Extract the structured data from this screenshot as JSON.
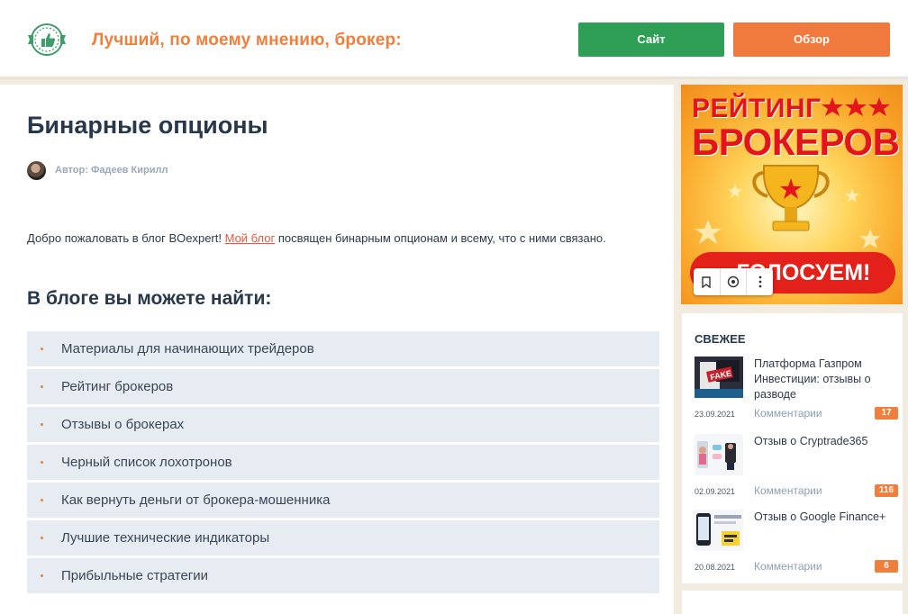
{
  "header": {
    "tagline": "Лучший, по моему мнению, брокер:",
    "site_button": "Сайт",
    "review_button": "Обзор",
    "colors": {
      "accent_orange": "#f07f3e",
      "site_green": "#2e9f55"
    }
  },
  "article": {
    "title": "Бинарные опционы",
    "author": "Автор: Фадеев Кирилл",
    "intro_before": "Добро пожаловать в блог BOexpert! ",
    "intro_link": "Мой блог",
    "intro_after": " посвящен бинарным опционам и всему, что с ними связано.",
    "section_heading": "В блоге вы можете найти:",
    "list": [
      "Материалы для начинающих трейдеров",
      "Рейтинг брокеров",
      "Отзывы о брокерах",
      "Черный список лохотронов",
      "Как вернуть деньги от брокера-мошенника",
      "Лучшие технические индикаторы",
      "Прибыльные стратегии"
    ]
  },
  "banner": {
    "line1": "РЕЙТИНГ",
    "line2": "БРОКЕРОВ",
    "vote": "ГОЛОСУЕМ!",
    "controls": [
      "bookmark-icon",
      "share-icon",
      "more-icon"
    ]
  },
  "sidebar": {
    "title": "СВЕЖЕЕ",
    "posts": [
      {
        "title": "Платформа Газпром Инвестиции: отзывы о разводе",
        "date": "23.09.2021",
        "comments_label": "Комментарии",
        "count": "17"
      },
      {
        "title": "Отзыв о Cryptrade365",
        "date": "02.09.2021",
        "comments_label": "Комментарии",
        "count": "116"
      },
      {
        "title": "Отзыв о Google Finance+",
        "date": "20.08.2021",
        "comments_label": "Комментарии",
        "count": "6"
      }
    ]
  }
}
